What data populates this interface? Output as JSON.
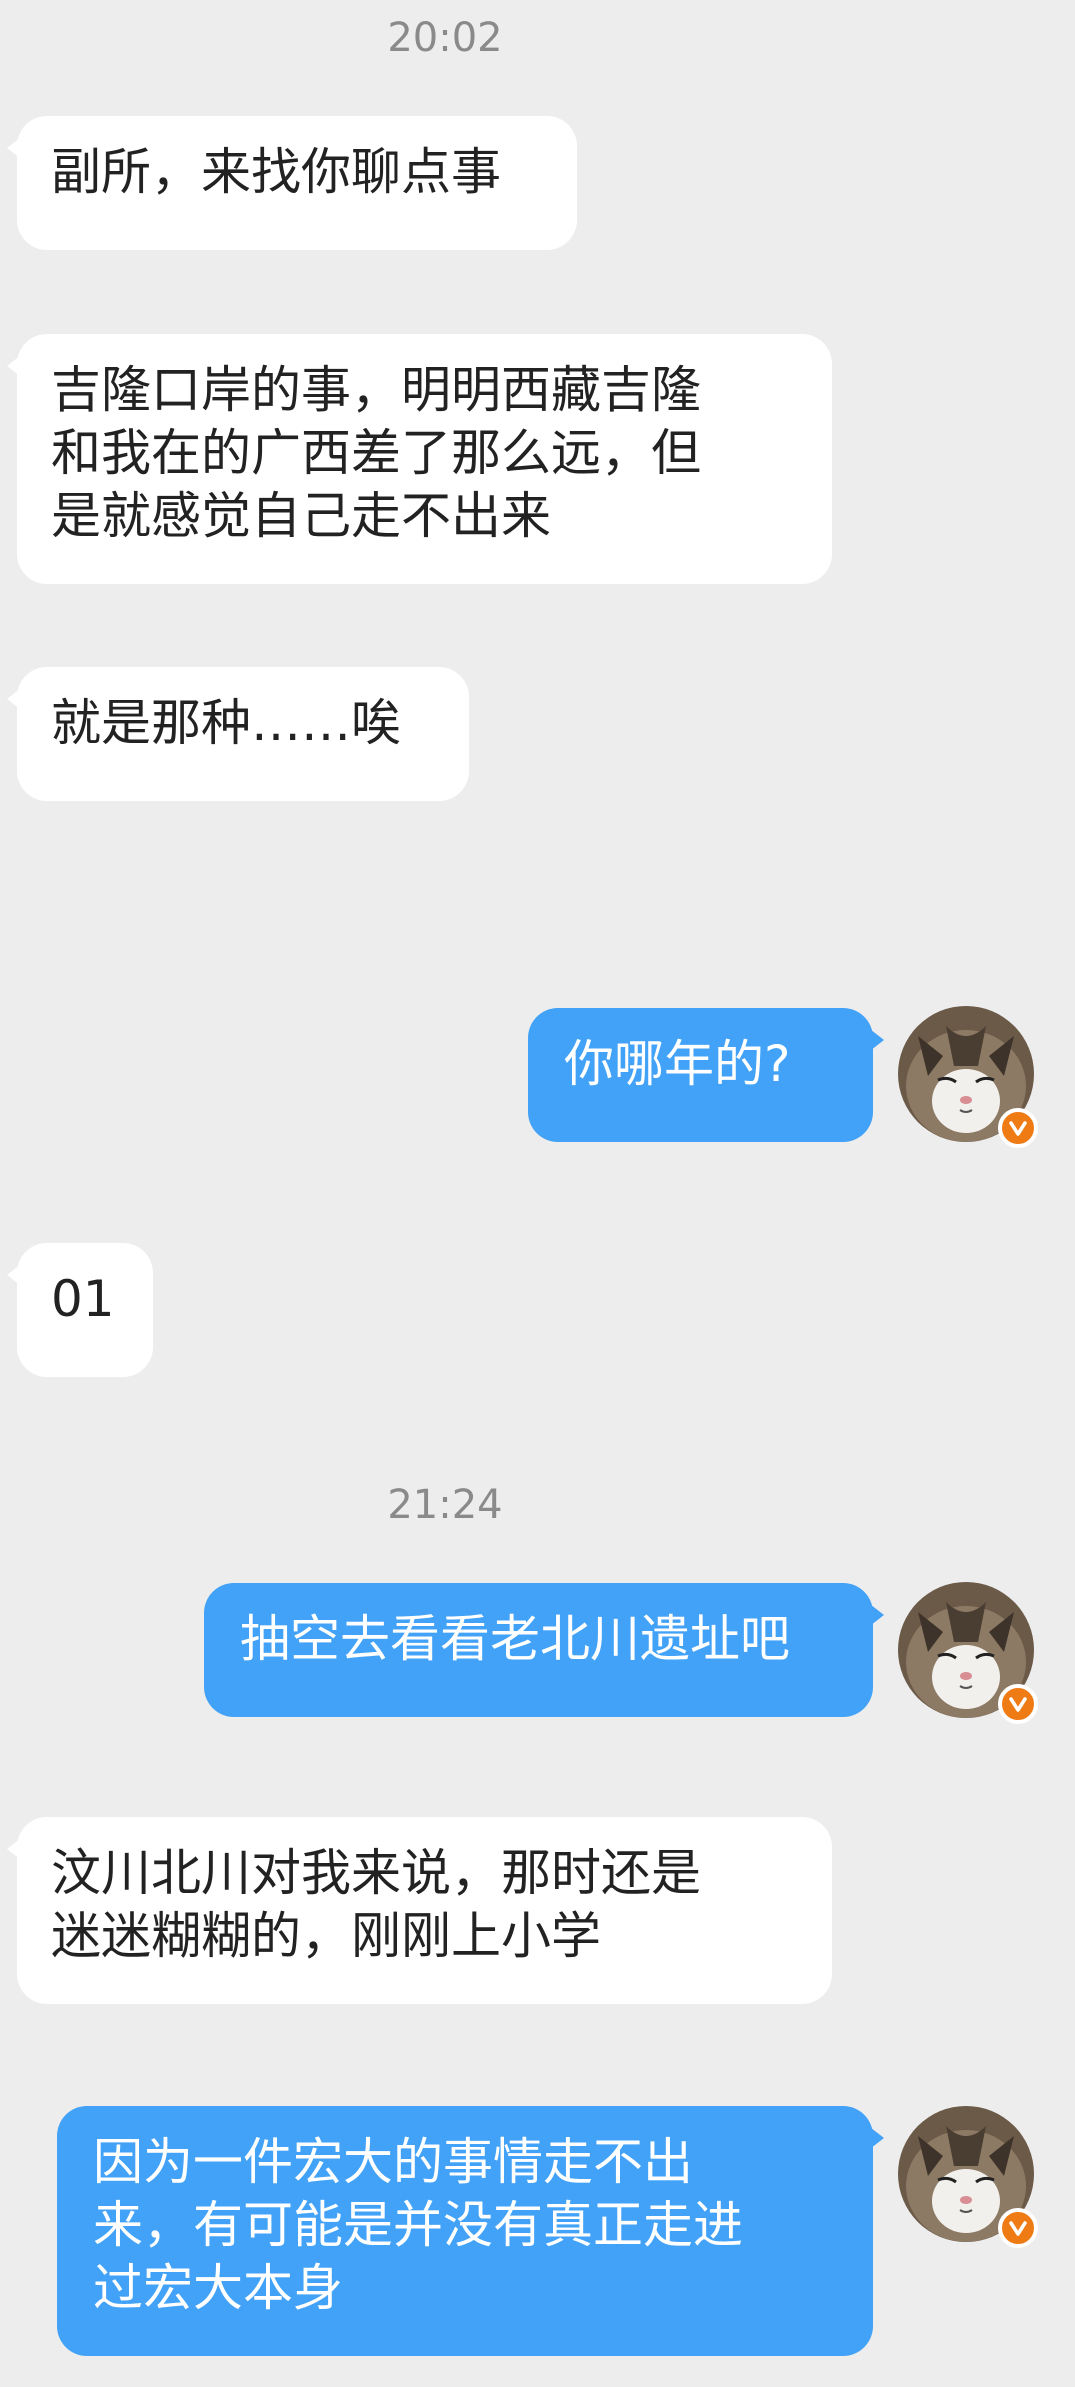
{
  "timestamps": [
    "20:02",
    "21:24"
  ],
  "messages": [
    {
      "side": "in",
      "text": "副所，来找你聊点事"
    },
    {
      "side": "in",
      "text": "吉隆口岸的事，明明西藏吉隆\n和我在的广西差了那么远，但\n是就感觉自己走不出来"
    },
    {
      "side": "in",
      "text": "就是那种……唉"
    },
    {
      "side": "out",
      "text": "你哪年的?"
    },
    {
      "side": "in",
      "text": "01"
    },
    {
      "side": "out",
      "text": "抽空去看看老北川遗址吧"
    },
    {
      "side": "in",
      "text": "汶川北川对我来说，那时还是\n迷迷糊糊的，刚刚上小学"
    },
    {
      "side": "out",
      "text": "因为一件宏大的事情走不出\n来，有可能是并没有真正走进\n过宏大本身"
    }
  ],
  "avatar": {
    "icon": "cat-avatar-icon",
    "badge_icon": "verified-v-badge-icon"
  },
  "colors": {
    "background": "#ededed",
    "incoming_bubble": "#ffffff",
    "outgoing_bubble": "#42a2f7",
    "badge": "#ef7b14"
  }
}
